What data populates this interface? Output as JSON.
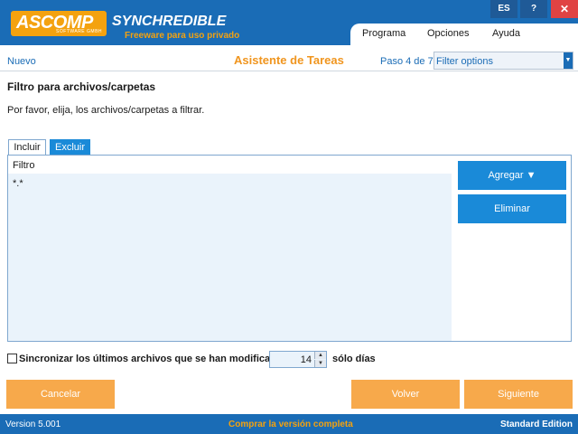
{
  "header": {
    "logo_text": "ASCOMP",
    "logo_sub": "SOFTWARE GMBH",
    "app_title": "SYNCHREDIBLE",
    "tagline": "Freeware para uso privado",
    "lang": "ES",
    "help": "?",
    "close": "✕"
  },
  "menu": {
    "items": [
      "Programa",
      "Opciones",
      "Ayuda"
    ]
  },
  "subheader": {
    "new_label": "Nuevo",
    "wizard_title": "Asistente de Tareas",
    "step_label": "Paso 4 de 7:",
    "step_value": "Filter options"
  },
  "section": {
    "title": "Filtro para archivos/carpetas",
    "instruction": "Por favor, elija, los archivos/carpetas a filtrar."
  },
  "tabs": [
    "Incluir",
    "Excluir"
  ],
  "filter_table": {
    "header": "Filtro",
    "rows": [
      "*.*"
    ]
  },
  "side_buttons": {
    "add": "Agregar ▼",
    "remove": "Eliminar"
  },
  "sync": {
    "label": "Sincronizar los últimos archivos que se han modificado",
    "days_value": "14",
    "suffix": "sólo días",
    "checked": false
  },
  "bottom_buttons": {
    "cancel": "Cancelar",
    "back": "Volver",
    "next": "Siguiente"
  },
  "status": {
    "version": "Version 5.001",
    "buy": "Comprar la versión completa",
    "edition": "Standard Edition"
  },
  "colors": {
    "primary_blue": "#1a6cb6",
    "accent_orange": "#f4a20f",
    "button_blue": "#1a8ad8",
    "button_orange": "#f7a94b"
  }
}
